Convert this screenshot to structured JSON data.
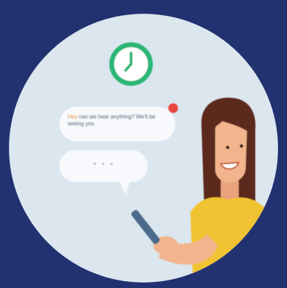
{
  "scene": {
    "colors": {
      "background": "#223170",
      "circle": "#dbe6ef",
      "clock_ring": "#2bb673",
      "notification_dot": "#e8463f",
      "hair": "#5c2a1c",
      "shirt": "#f1c232",
      "skin": "#f2b48c"
    },
    "icons": [
      "clock-icon",
      "chat-bubble-icon",
      "notification-dot-icon",
      "typing-bubble-icon",
      "phone-icon"
    ]
  },
  "chat": {
    "message_highlight": "Hey",
    "message_rest": " can we hear anything? We'll be seeing you",
    "typing_indicator": "• • •"
  }
}
